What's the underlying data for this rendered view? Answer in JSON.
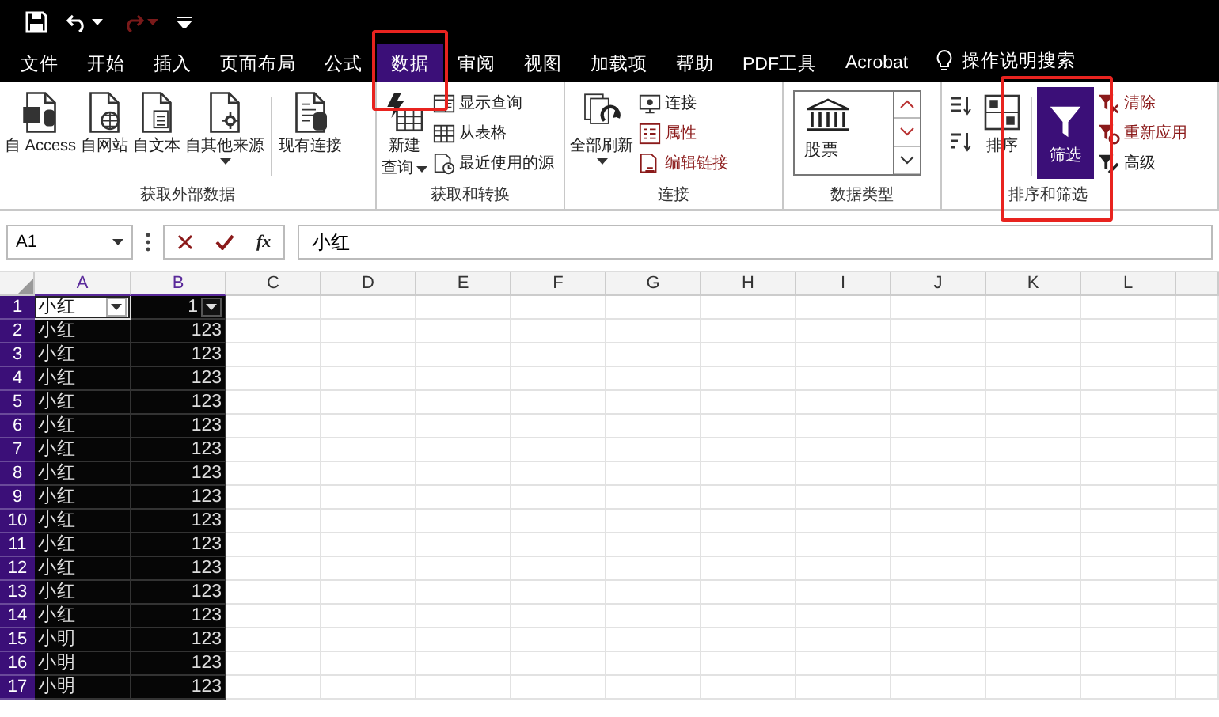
{
  "tabs": [
    {
      "label": "文件",
      "selected": false
    },
    {
      "label": "开始",
      "selected": false
    },
    {
      "label": "插入",
      "selected": false
    },
    {
      "label": "页面布局",
      "selected": false
    },
    {
      "label": "公式",
      "selected": false
    },
    {
      "label": "数据",
      "selected": true
    },
    {
      "label": "审阅",
      "selected": false
    },
    {
      "label": "视图",
      "selected": false
    },
    {
      "label": "加载项",
      "selected": false
    },
    {
      "label": "帮助",
      "selected": false
    },
    {
      "label": "PDF工具",
      "selected": false
    },
    {
      "label": "Acrobat",
      "selected": false
    }
  ],
  "tell_me": {
    "placeholder": "操作说明搜索"
  },
  "ribbon_groups": [
    {
      "title": "获取外部数据",
      "items": [
        {
          "kind": "large",
          "label": "自 Access",
          "dropdown": false,
          "on": false
        },
        {
          "kind": "large",
          "label": "自网站",
          "dropdown": false,
          "on": false
        },
        {
          "kind": "large",
          "label": "自文本",
          "dropdown": false,
          "on": false
        },
        {
          "kind": "large",
          "label": "自其他来源",
          "dropdown": true,
          "on": false
        },
        {
          "kind": "divider"
        },
        {
          "kind": "large",
          "label": "现有连接",
          "dropdown": false,
          "on": false
        }
      ]
    },
    {
      "title": "获取和转换",
      "items": [
        {
          "kind": "large",
          "label_lines": [
            "新建",
            "查询"
          ],
          "dropdown": true,
          "on": false
        },
        {
          "kind": "small_stack",
          "buttons": [
            {
              "label": "显示查询",
              "disabled": false
            },
            {
              "label": "从表格",
              "disabled": false
            },
            {
              "label": "最近使用的源",
              "disabled": false
            }
          ]
        }
      ]
    },
    {
      "title": "连接",
      "items": [
        {
          "kind": "large",
          "label": "全部刷新",
          "dropdown": true,
          "on": false
        },
        {
          "kind": "small_stack",
          "buttons": [
            {
              "label": "连接",
              "disabled": false
            },
            {
              "label": "属性",
              "disabled": true
            },
            {
              "label": "编辑链接",
              "disabled": true
            }
          ]
        }
      ]
    },
    {
      "title": "数据类型",
      "items": [
        {
          "kind": "gallery",
          "label": "股票"
        }
      ]
    },
    {
      "title": "排序和筛选",
      "items": [
        {
          "kind": "sort_buttons"
        },
        {
          "kind": "large",
          "label": "排序",
          "dropdown": false,
          "on": false
        },
        {
          "kind": "divider"
        },
        {
          "kind": "large",
          "label": "筛选",
          "dropdown": false,
          "on": true
        },
        {
          "kind": "small_stack",
          "buttons": [
            {
              "label": "清除",
              "disabled": true
            },
            {
              "label": "重新应用",
              "disabled": true
            },
            {
              "label": "高级",
              "disabled": false
            }
          ]
        }
      ]
    }
  ],
  "formula_bar": {
    "name_box": "A1",
    "function_label": "fx",
    "formula": "小红"
  },
  "sheet": {
    "columns": [
      {
        "label": "A",
        "selected": true
      },
      {
        "label": "B",
        "selected": true
      },
      {
        "label": "C",
        "selected": false
      },
      {
        "label": "D",
        "selected": false
      },
      {
        "label": "E",
        "selected": false
      },
      {
        "label": "F",
        "selected": false
      },
      {
        "label": "G",
        "selected": false
      },
      {
        "label": "H",
        "selected": false
      },
      {
        "label": "I",
        "selected": false
      },
      {
        "label": "J",
        "selected": false
      },
      {
        "label": "K",
        "selected": false
      },
      {
        "label": "L",
        "selected": false
      }
    ],
    "rows": [
      {
        "label": "1",
        "selected": true,
        "cells": [
          {
            "text": "小红",
            "selected": true,
            "active": true,
            "filter": true
          },
          {
            "text": "1",
            "selected": true,
            "active": false,
            "filter": true
          }
        ]
      },
      {
        "label": "2",
        "selected": true,
        "cells": [
          {
            "text": "小红",
            "selected": true,
            "active": false,
            "filter": false
          },
          {
            "text": "123",
            "selected": true,
            "active": false,
            "filter": false
          }
        ]
      },
      {
        "label": "3",
        "selected": true,
        "cells": [
          {
            "text": "小红",
            "selected": true,
            "active": false,
            "filter": false
          },
          {
            "text": "123",
            "selected": true,
            "active": false,
            "filter": false
          }
        ]
      },
      {
        "label": "4",
        "selected": true,
        "cells": [
          {
            "text": "小红",
            "selected": true,
            "active": false,
            "filter": false
          },
          {
            "text": "123",
            "selected": true,
            "active": false,
            "filter": false
          }
        ]
      },
      {
        "label": "5",
        "selected": true,
        "cells": [
          {
            "text": "小红",
            "selected": true,
            "active": false,
            "filter": false
          },
          {
            "text": "123",
            "selected": true,
            "active": false,
            "filter": false
          }
        ]
      },
      {
        "label": "6",
        "selected": true,
        "cells": [
          {
            "text": "小红",
            "selected": true,
            "active": false,
            "filter": false
          },
          {
            "text": "123",
            "selected": true,
            "active": false,
            "filter": false
          }
        ]
      },
      {
        "label": "7",
        "selected": true,
        "cells": [
          {
            "text": "小红",
            "selected": true,
            "active": false,
            "filter": false
          },
          {
            "text": "123",
            "selected": true,
            "active": false,
            "filter": false
          }
        ]
      },
      {
        "label": "8",
        "selected": true,
        "cells": [
          {
            "text": "小红",
            "selected": true,
            "active": false,
            "filter": false
          },
          {
            "text": "123",
            "selected": true,
            "active": false,
            "filter": false
          }
        ]
      },
      {
        "label": "9",
        "selected": true,
        "cells": [
          {
            "text": "小红",
            "selected": true,
            "active": false,
            "filter": false
          },
          {
            "text": "123",
            "selected": true,
            "active": false,
            "filter": false
          }
        ]
      },
      {
        "label": "10",
        "selected": true,
        "cells": [
          {
            "text": "小红",
            "selected": true,
            "active": false,
            "filter": false
          },
          {
            "text": "123",
            "selected": true,
            "active": false,
            "filter": false
          }
        ]
      },
      {
        "label": "11",
        "selected": true,
        "cells": [
          {
            "text": "小红",
            "selected": true,
            "active": false,
            "filter": false
          },
          {
            "text": "123",
            "selected": true,
            "active": false,
            "filter": false
          }
        ]
      },
      {
        "label": "12",
        "selected": true,
        "cells": [
          {
            "text": "小红",
            "selected": true,
            "active": false,
            "filter": false
          },
          {
            "text": "123",
            "selected": true,
            "active": false,
            "filter": false
          }
        ]
      },
      {
        "label": "13",
        "selected": true,
        "cells": [
          {
            "text": "小红",
            "selected": true,
            "active": false,
            "filter": false
          },
          {
            "text": "123",
            "selected": true,
            "active": false,
            "filter": false
          }
        ]
      },
      {
        "label": "14",
        "selected": true,
        "cells": [
          {
            "text": "小红",
            "selected": true,
            "active": false,
            "filter": false
          },
          {
            "text": "123",
            "selected": true,
            "active": false,
            "filter": false
          }
        ]
      },
      {
        "label": "15",
        "selected": true,
        "cells": [
          {
            "text": "小明",
            "selected": true,
            "active": false,
            "filter": false
          },
          {
            "text": "123",
            "selected": true,
            "active": false,
            "filter": false
          }
        ]
      },
      {
        "label": "16",
        "selected": true,
        "cells": [
          {
            "text": "小明",
            "selected": true,
            "active": false,
            "filter": false
          },
          {
            "text": "123",
            "selected": true,
            "active": false,
            "filter": false
          }
        ]
      },
      {
        "label": "17",
        "selected": true,
        "cells": [
          {
            "text": "小明",
            "selected": true,
            "active": false,
            "filter": false
          },
          {
            "text": "123",
            "selected": true,
            "active": false,
            "filter": false
          }
        ]
      }
    ]
  }
}
